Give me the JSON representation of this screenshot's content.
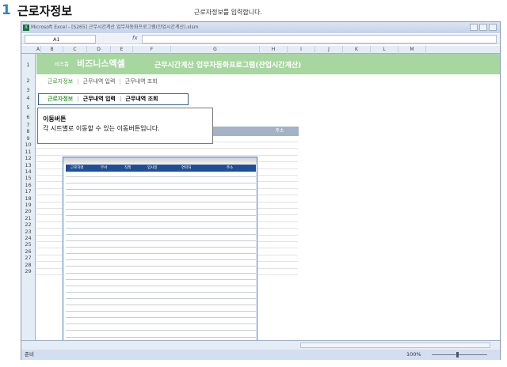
{
  "step": {
    "number": "1",
    "title": "근로자정보",
    "caption": "근로자정보를 입력합니다."
  },
  "window": {
    "title": "Microsoft Excel - [S265] 근무시간계산 업무자동화프로그램(잔업시간계산).xlsm"
  },
  "formula_bar": {
    "name_box": "A1",
    "fx_symbol": "fx"
  },
  "columns": [
    "A",
    "B",
    "C",
    "D",
    "E",
    "F",
    "G",
    "H",
    "I",
    "J",
    "K",
    "L",
    "M"
  ],
  "rows": [
    "1",
    "2",
    "3",
    "4",
    "5",
    "6",
    "7",
    "8",
    "9",
    "10",
    "11",
    "12",
    "13",
    "14",
    "15",
    "16",
    "17",
    "18",
    "19",
    "20",
    "21",
    "22",
    "23",
    "24",
    "25",
    "26",
    "27",
    "28",
    "29"
  ],
  "banner": {
    "brand_small": "비즈폼",
    "brand": "비즈니스엑셀",
    "program_title": "근무시간계산 업무자동화프로그램(잔업시간계산)"
  },
  "nav": [
    "근로자정보",
    "근무내역 입력",
    "근무내역 조회"
  ],
  "callout": {
    "title": "이동버튼",
    "body": "각 시트별로 이동할 수 있는 이동버튼입니다."
  },
  "header_band": "주소",
  "table": {
    "headers": [
      "근로자명",
      "부서",
      "직책",
      "입사일",
      "연락처",
      "주소"
    ]
  },
  "status": {
    "ready": "준비",
    "zoom": "100%"
  },
  "colors": {
    "banner": "#a7d6a1",
    "table_header": "#1f4e99",
    "accent_green": "#3e9a34"
  }
}
